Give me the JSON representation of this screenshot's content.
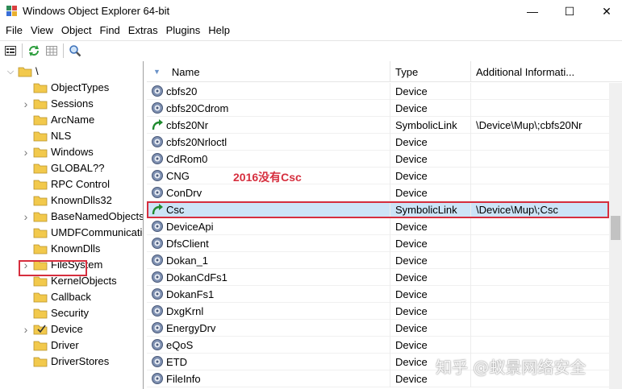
{
  "window": {
    "title": "Windows Object Explorer 64-bit",
    "min_glyph": "—",
    "max_glyph": "☐",
    "close_glyph": "✕"
  },
  "menu": [
    "File",
    "View",
    "Object",
    "Find",
    "Extras",
    "Plugins",
    "Help"
  ],
  "tree": [
    {
      "label": "\\",
      "level": 0,
      "expander": "v"
    },
    {
      "label": "ObjectTypes",
      "level": 1,
      "expander": ""
    },
    {
      "label": "Sessions",
      "level": 1,
      "expander": ">"
    },
    {
      "label": "ArcName",
      "level": 1,
      "expander": ""
    },
    {
      "label": "NLS",
      "level": 1,
      "expander": ""
    },
    {
      "label": "Windows",
      "level": 1,
      "expander": ">"
    },
    {
      "label": "GLOBAL??",
      "level": 1,
      "expander": ""
    },
    {
      "label": "RPC Control",
      "level": 1,
      "expander": ""
    },
    {
      "label": "KnownDlls32",
      "level": 1,
      "expander": ""
    },
    {
      "label": "BaseNamedObjects",
      "level": 1,
      "expander": ">"
    },
    {
      "label": "UMDFCommunicatio",
      "level": 1,
      "expander": ""
    },
    {
      "label": "KnownDlls",
      "level": 1,
      "expander": ""
    },
    {
      "label": "FileSystem",
      "level": 1,
      "expander": ">"
    },
    {
      "label": "KernelObjects",
      "level": 1,
      "expander": ""
    },
    {
      "label": "Callback",
      "level": 1,
      "expander": ""
    },
    {
      "label": "Security",
      "level": 1,
      "expander": ""
    },
    {
      "label": "Device",
      "level": 1,
      "expander": ">",
      "highlighted": true
    },
    {
      "label": "Driver",
      "level": 1,
      "expander": ""
    },
    {
      "label": "DriverStores",
      "level": 1,
      "expander": ""
    }
  ],
  "columns": {
    "name": "Name",
    "type": "Type",
    "info": "Additional Informati..."
  },
  "rows": [
    {
      "name": "cbfs20",
      "type": "Device",
      "info": "",
      "icon": "gear"
    },
    {
      "name": "cbfs20Cdrom",
      "type": "Device",
      "info": "",
      "icon": "gear"
    },
    {
      "name": "cbfs20Nr",
      "type": "SymbolicLink",
      "info": "\\Device\\Mup\\;cbfs20Nr",
      "icon": "link"
    },
    {
      "name": "cbfs20Nrloctl",
      "type": "Device",
      "info": "",
      "icon": "gear"
    },
    {
      "name": "CdRom0",
      "type": "Device",
      "info": "",
      "icon": "gear"
    },
    {
      "name": "CNG",
      "type": "Device",
      "info": "",
      "icon": "gear"
    },
    {
      "name": "ConDrv",
      "type": "Device",
      "info": "",
      "icon": "gear"
    },
    {
      "name": "Csc",
      "type": "SymbolicLink",
      "info": "\\Device\\Mup\\;Csc",
      "icon": "link",
      "selected": true
    },
    {
      "name": "DeviceApi",
      "type": "Device",
      "info": "",
      "icon": "gear"
    },
    {
      "name": "DfsClient",
      "type": "Device",
      "info": "",
      "icon": "gear"
    },
    {
      "name": "Dokan_1",
      "type": "Device",
      "info": "",
      "icon": "gear"
    },
    {
      "name": "DokanCdFs1",
      "type": "Device",
      "info": "",
      "icon": "gear"
    },
    {
      "name": "DokanFs1",
      "type": "Device",
      "info": "",
      "icon": "gear"
    },
    {
      "name": "DxgKrnl",
      "type": "Device",
      "info": "",
      "icon": "gear"
    },
    {
      "name": "EnergyDrv",
      "type": "Device",
      "info": "",
      "icon": "gear"
    },
    {
      "name": "eQoS",
      "type": "Device",
      "info": "",
      "icon": "gear"
    },
    {
      "name": "ETD",
      "type": "Device",
      "info": "",
      "icon": "gear"
    },
    {
      "name": "FileInfo",
      "type": "Device",
      "info": "",
      "icon": "gear"
    }
  ],
  "annotation": "2016没有Csc",
  "watermark": "知乎 @蚁景网络安全",
  "colors": {
    "highlight_red": "#d62e3e",
    "selection_blue": "#cce4f7",
    "folder_yellow": "#f2c94c"
  }
}
